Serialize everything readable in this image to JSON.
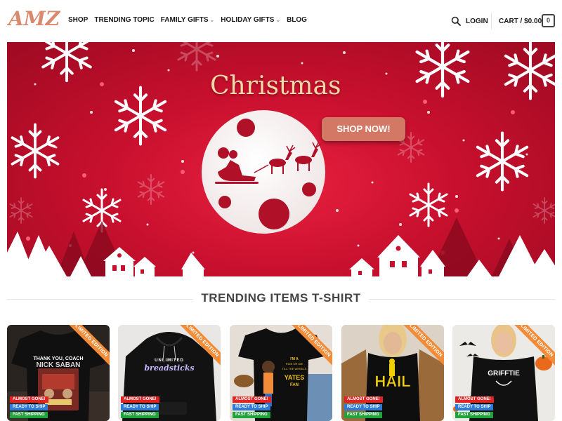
{
  "header": {
    "logo": "AMZ",
    "nav": [
      {
        "label": "SHOP",
        "dropdown": false
      },
      {
        "label": "TRENDING TOPIC",
        "dropdown": false
      },
      {
        "label": "FAMILY GIFTS",
        "dropdown": true
      },
      {
        "label": "HOLIDAY GIFTS",
        "dropdown": true
      },
      {
        "label": "BLOG",
        "dropdown": false
      }
    ],
    "search_icon": "search-icon",
    "login": "LOGIN",
    "cart_label": "CART / $0.00",
    "cart_count": "0"
  },
  "banner": {
    "title": "Christmas",
    "cta": "SHOP NOW!"
  },
  "section": {
    "title": "TRENDING ITEMS T-SHIRT"
  },
  "products": [
    {
      "ribbon": "LIMITED EDITION",
      "badges": [
        "ALMOST GONE!",
        "READY TO SHIP",
        "FAST SHIPPING"
      ],
      "print": [
        "THANK YOU, COACH",
        "NICK SABAN"
      ]
    },
    {
      "ribbon": "LIMITED EDITION",
      "badges": [
        "ALMOST GONE!",
        "READY TO SHIP",
        "FAST SHIPPING"
      ],
      "print": [
        "UNLIMITED",
        "breadsticks"
      ]
    },
    {
      "ribbon": "LIMITED EDITION",
      "badges": [
        "ALMOST GONE!",
        "READY TO SHIP",
        "FAST SHIPPING"
      ],
      "print": [
        "YATES",
        "FAN"
      ]
    },
    {
      "ribbon": "LIMITED EDITION",
      "badges": [
        "ALMOST GONE!",
        "READY TO SHIP",
        "FAST SHIPPING"
      ],
      "print": [
        "HAIL"
      ]
    },
    {
      "ribbon": "LIMITED EDITION",
      "badges": [
        "ALMOST GONE!",
        "READY TO SHIP",
        "FAST SHIPPING"
      ],
      "print": [
        "GRIFFTIE"
      ]
    }
  ],
  "colors": {
    "brand": "#d98a6e",
    "banner_red": "#c8102e",
    "ribbon": "#f28c38",
    "badge_red": "#e02424",
    "badge_blue": "#2d7bd6",
    "badge_green": "#21a33c"
  }
}
